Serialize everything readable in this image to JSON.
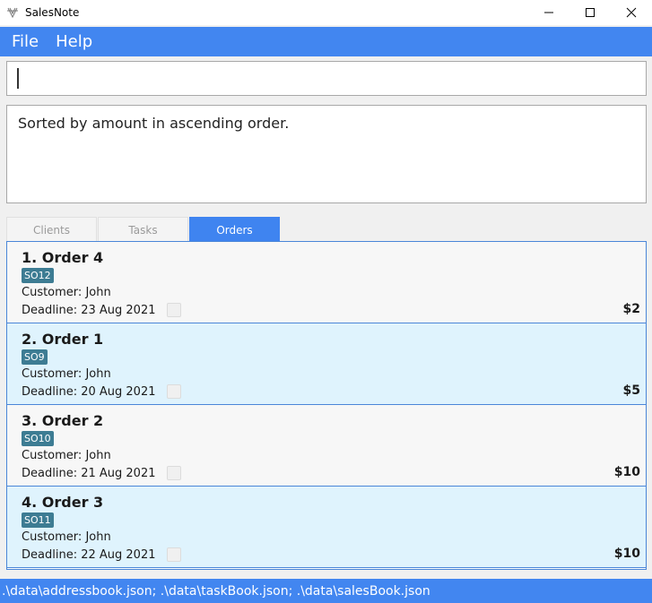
{
  "window": {
    "title": "SalesNote",
    "icon": "app-logo-icon"
  },
  "menu": {
    "items": [
      "File",
      "Help"
    ]
  },
  "command": {
    "value": ""
  },
  "result": {
    "text": "Sorted by amount in ascending order."
  },
  "tabs": [
    {
      "label": "Clients",
      "active": false
    },
    {
      "label": "Tasks",
      "active": false
    },
    {
      "label": "Orders",
      "active": true
    }
  ],
  "orders": [
    {
      "title": "1. Order 4",
      "tag": "SO12",
      "customer_label": "Customer:",
      "customer": "John",
      "deadline_label": "Deadline:",
      "deadline": "23 Aug 2021",
      "amount": "$2"
    },
    {
      "title": "2. Order 1",
      "tag": "SO9",
      "customer_label": "Customer:",
      "customer": "John",
      "deadline_label": "Deadline:",
      "deadline": "20 Aug 2021",
      "amount": "$5"
    },
    {
      "title": "3. Order 2",
      "tag": "SO10",
      "customer_label": "Customer:",
      "customer": "John",
      "deadline_label": "Deadline:",
      "deadline": "21 Aug 2021",
      "amount": "$10"
    },
    {
      "title": "4. Order 3",
      "tag": "SO11",
      "customer_label": "Customer:",
      "customer": "John",
      "deadline_label": "Deadline:",
      "deadline": "22 Aug 2021",
      "amount": "$10"
    }
  ],
  "status": {
    "text": ".\\data\\addressbook.json; .\\data\\taskBook.json; .\\data\\salesBook.json"
  },
  "colors": {
    "accent": "#4286f0",
    "row_alt": "#dff3fd",
    "tag": "#3d7c93"
  }
}
